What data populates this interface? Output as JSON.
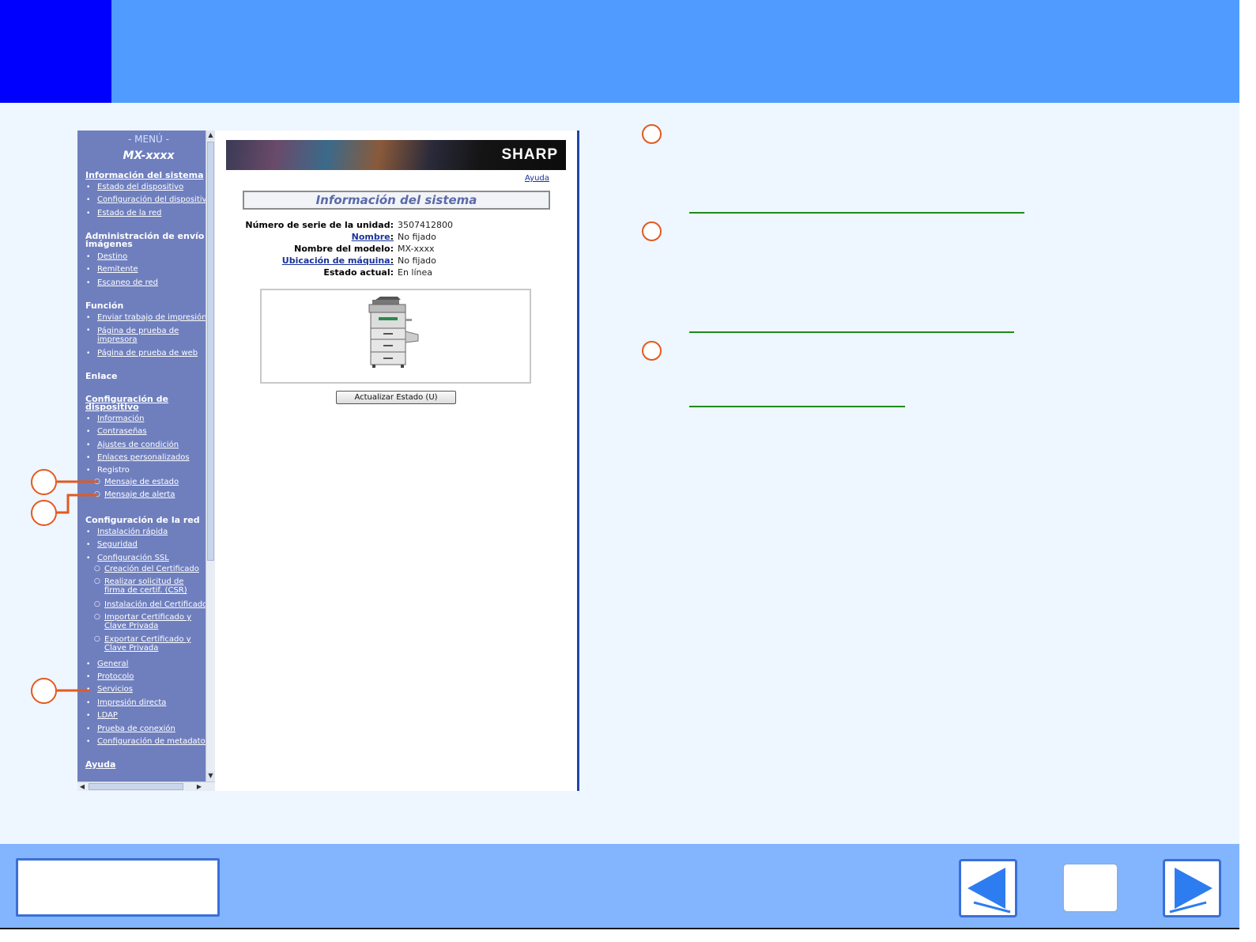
{
  "menu": {
    "title": "- MENÚ -",
    "model": "MX-xxxx",
    "sections": {
      "system_info": "Información del sistema",
      "image_send": "Administración de envío de imágenes",
      "function": "Función",
      "link": "Enlace",
      "device_config": "Configuración de dispositivo",
      "network_config": "Configuración de la red",
      "help": "Ayuda"
    },
    "items": {
      "device_status": "Estado del dispositivo",
      "device_configuration": "Configuración del dispositivo",
      "network_status": "Estado de la red",
      "destination": "Destino",
      "sender": "Remitente",
      "network_scan": "Escaneo de red",
      "send_print_job": "Enviar trabajo de impresión",
      "printer_test_page": "Página de prueba de impresora",
      "web_test_page": "Página de prueba de web",
      "information": "Información",
      "passwords": "Contraseñas",
      "condition_settings": "Ajustes de condición",
      "custom_links": "Enlaces personalizados",
      "registry": "Registro",
      "status_message": "Mensaje de estado",
      "alert_message": "Mensaje de alerta",
      "quick_install": "Instalación rápida",
      "security": "Seguridad",
      "ssl_config": "Configuración SSL",
      "cert_creation": "Creación del Certificado",
      "cert_request": "Realizar solicitud de firma de certif. (CSR)",
      "cert_install": "Instalación del Certificado",
      "import_cert": "Importar Certificado y Clave Privada",
      "export_cert": "Exportar Certificado y Clave Privada",
      "general": "General",
      "protocol": "Protocolo",
      "services": "Servicios",
      "direct_print": "Impresión directa",
      "ldap": "LDAP",
      "connection_test": "Prueba de conexión",
      "metadata_config": "Configuración de metadatos"
    }
  },
  "page": {
    "brand": "SHARP",
    "help_link": "Ayuda",
    "title": "Información del sistema",
    "rows": [
      {
        "label": "Número de serie de la unidad:",
        "value": "3507412800"
      },
      {
        "label": "Nombre",
        "value": "No fijado"
      },
      {
        "label": "Nombre del modelo:",
        "value": "MX-xxxx"
      },
      {
        "label": "Ubicación de máquina",
        "value": "No fijado"
      },
      {
        "label": "Estado actual:",
        "value": "En línea"
      }
    ],
    "update_button": "Actualizar Estado (U)"
  },
  "colors": {
    "header_blue": "#4f9bff",
    "corner_blue": "#0000ff",
    "footer_blue": "#83b5ff",
    "callout_orange": "#e25a1f",
    "underline_green": "#1c8c1c"
  },
  "icons": {
    "scroll_up": "▲",
    "scroll_down": "▼",
    "scroll_left": "◀",
    "scroll_right": "▶"
  }
}
